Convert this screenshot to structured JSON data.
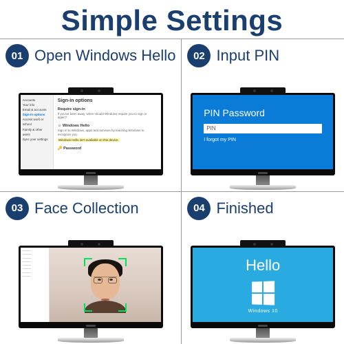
{
  "title": "Simple Settings",
  "steps": [
    {
      "num": "01",
      "title": "Open Windows Hello"
    },
    {
      "num": "02",
      "title": "Input PIN"
    },
    {
      "num": "03",
      "title": "Face Collection"
    },
    {
      "num": "04",
      "title": "Finished"
    }
  ],
  "step1": {
    "sidebar_heading": "Accounts",
    "sidebar_items": [
      "Your info",
      "Email & accounts",
      "Sign-in options",
      "Access work or school",
      "Family & other users",
      "Sync your settings"
    ],
    "page_title": "Sign-in options",
    "section_require": "Require sign-in",
    "require_text": "If you've been away, when should Windows require you to sign in again?",
    "section_hello": "Windows Hello",
    "hello_text": "Sign in to Windows, apps and services by teaching Windows to recognize you.",
    "hello_highlight": "Windows Hello isn't available on this device.",
    "password_label": "Password"
  },
  "step2": {
    "heading": "PIN Password",
    "placeholder": "PIN",
    "forgot": "I forgot my PIN"
  },
  "step4": {
    "greeting": "Hello",
    "os_label": "Windows 10"
  }
}
